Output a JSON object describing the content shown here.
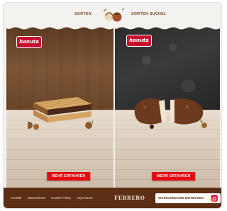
{
  "header": {
    "nav_left_label": "SORTEN",
    "nav_right_label": "SORTEN SUCHEL"
  },
  "panels": [
    {
      "brand_label": "hanuta",
      "cta_label": "MEHR ERFAHREN",
      "product": "wafer-icon"
    },
    {
      "brand_label": "hanuta",
      "cta_label": "MEHR ERFAHREN",
      "product": "chocolate-bar-icon"
    }
  ],
  "footer": {
    "links": [
      "Kontakt",
      "Datenschutz",
      "Cookie-Policy",
      "Impressum"
    ],
    "brand_label": "FERRERO",
    "promo_label": "SCHOKOREKORD ENTDECKEN"
  },
  "colors": {
    "accent_red": "#e30613",
    "footer_brown": "#5c2e16",
    "nav_brown": "#7a3f1e"
  }
}
